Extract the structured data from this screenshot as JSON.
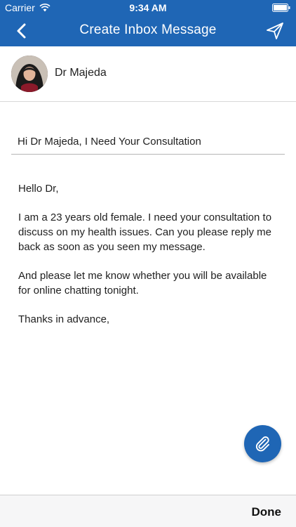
{
  "status_bar": {
    "carrier": "Carrier",
    "time": "9:34 AM"
  },
  "nav": {
    "title": "Create Inbox Message",
    "back_icon": "chevron-left-icon",
    "send_icon": "paper-plane-icon"
  },
  "recipient": {
    "name": "Dr Majeda"
  },
  "subject": {
    "value": "Hi Dr Majeda, I Need Your Consultation"
  },
  "message": {
    "paragraphs": [
      "Hello Dr,",
      "I am a 23 years old female. I need your consultation to discuss on my health issues. Can you please reply me back as soon as you seen my message.",
      "And please let me know whether you will be available for online chatting tonight.",
      "Thanks in advance,"
    ]
  },
  "attach": {
    "icon": "paperclip-icon"
  },
  "accessory": {
    "done_label": "Done"
  },
  "colors": {
    "primary": "#1f66b5",
    "accessory_bg": "#f6f6f7"
  }
}
